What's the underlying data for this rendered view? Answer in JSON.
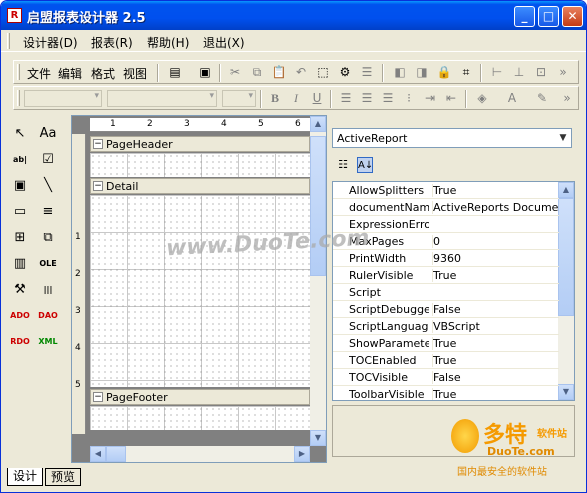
{
  "window": {
    "title": "启盟报表设计器 2.5",
    "icon_letter": "R"
  },
  "menu": [
    "设计器(D)",
    "报表(R)",
    "帮助(H)",
    "退出(X)"
  ],
  "toolbar_text": [
    "文件",
    "编辑",
    "格式",
    "视图"
  ],
  "toolbar_icons_row1": [
    "properties-icon",
    "grid-icon",
    "cut-icon",
    "copy-icon",
    "paste-icon",
    "undo-icon",
    "select-all-icon",
    "zoom-icon",
    "align-icon",
    "bring-front-icon",
    "send-back-icon",
    "lock-icon",
    "snap-icon",
    "h-spacing-icon",
    "v-spacing-icon",
    "size-icon"
  ],
  "toolbar_icons_row2": [
    "bold-icon",
    "italic-icon",
    "underline-icon",
    "align-left-icon",
    "align-center-icon",
    "align-right-icon",
    "bullets-icon",
    "indent-icon",
    "outdent-icon",
    "fill-color-icon",
    "font-color-icon",
    "line-color-icon"
  ],
  "format_buttons": {
    "bold": "B",
    "italic": "I",
    "underline": "U"
  },
  "toolbox": [
    {
      "name": "pointer-icon",
      "glyph": "↖"
    },
    {
      "name": "label-icon",
      "glyph": "Aa"
    },
    {
      "name": "textbox-icon",
      "glyph": "ab|"
    },
    {
      "name": "checkbox-icon",
      "glyph": "☑"
    },
    {
      "name": "picture-icon",
      "glyph": "▣"
    },
    {
      "name": "line-icon",
      "glyph": "╲"
    },
    {
      "name": "shape-icon",
      "glyph": "▭"
    },
    {
      "name": "richtext-icon",
      "glyph": "≡"
    },
    {
      "name": "subreport-icon",
      "glyph": "⊞"
    },
    {
      "name": "pagebreak-icon",
      "glyph": "⧉"
    },
    {
      "name": "barcode-icon",
      "glyph": "▥"
    },
    {
      "name": "ole-icon",
      "glyph": "OLE"
    },
    {
      "name": "tools-icon",
      "glyph": "⚒"
    },
    {
      "name": "barcode2-icon",
      "glyph": "|||"
    },
    {
      "name": "ado-icon",
      "glyph": "ADO"
    },
    {
      "name": "dao-icon",
      "glyph": "DAO"
    },
    {
      "name": "rdo-icon",
      "glyph": "RDO"
    },
    {
      "name": "xml-icon",
      "glyph": "XML"
    }
  ],
  "ruler_marks": [
    "1",
    "2",
    "3",
    "4",
    "5",
    "6"
  ],
  "vruler_marks": [
    "1",
    "2",
    "3",
    "4",
    "5"
  ],
  "bands": {
    "header": "PageHeader",
    "detail": "Detail",
    "footer": "PageFooter"
  },
  "props": {
    "selected_object": "ActiveReport",
    "rows": [
      {
        "name": "AllowSplitters",
        "value": "True"
      },
      {
        "name": "documentName",
        "value": "ActiveReports Document"
      },
      {
        "name": "ExpressionErrorM",
        "value": ""
      },
      {
        "name": "MaxPages",
        "value": "0"
      },
      {
        "name": "PrintWidth",
        "value": "9360"
      },
      {
        "name": "RulerVisible",
        "value": "True"
      },
      {
        "name": "Script",
        "value": ""
      },
      {
        "name": "ScriptDebuggerE",
        "value": "False"
      },
      {
        "name": "ScriptLanguage",
        "value": "VBScript"
      },
      {
        "name": "ShowParameterUI",
        "value": "True"
      },
      {
        "name": "TOCEnabled",
        "value": "True"
      },
      {
        "name": "TOCVisible",
        "value": "False"
      },
      {
        "name": "ToolbarVisible",
        "value": "True"
      }
    ]
  },
  "tabs": [
    "设计",
    "预览"
  ],
  "watermarks": {
    "center": "www.DuoTe.com",
    "logo_big": "多特",
    "logo_small": "软件站",
    "logo_url": "DuoTe.com",
    "logo_slogan": "国内最安全的软件站"
  }
}
